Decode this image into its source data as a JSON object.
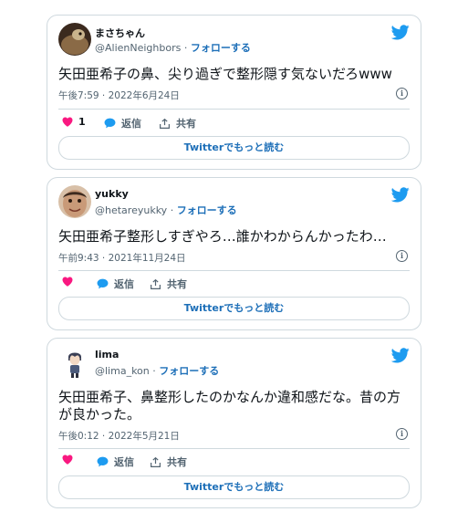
{
  "tweets": [
    {
      "name": "まさちゃん",
      "handle": "@AlienNeighbors",
      "follow_label": "フォローする",
      "text": "矢田亜希子の鼻、尖り過ぎで整形隠す気ないだろwww",
      "timestamp": "午後7:59 · 2022年6月24日",
      "like_count": "1",
      "reply_label": "返信",
      "share_label": "共有",
      "read_more_label": "Twitterでもっと読む"
    },
    {
      "name": "yukky",
      "handle": "@hetareyukky",
      "follow_label": "フォローする",
      "text": "矢田亜希子整形しすぎやろ…誰かわからんかったわ…",
      "timestamp": "午前9:43 · 2021年11月24日",
      "like_count": "",
      "reply_label": "返信",
      "share_label": "共有",
      "read_more_label": "Twitterでもっと読む"
    },
    {
      "name": "lima",
      "handle": "@lima_kon",
      "follow_label": "フォローする",
      "text": "矢田亜希子、鼻整形したのかなんか違和感だな。昔の方が良かった。",
      "timestamp": "午後0:12 · 2022年5月21日",
      "like_count": "",
      "reply_label": "返信",
      "share_label": "共有",
      "read_more_label": "Twitterでもっと読む"
    }
  ],
  "colors": {
    "accent": "#1d9bf0",
    "link": "#1d6fb8",
    "like": "#f91880",
    "muted": "#536471",
    "border": "#cfd9de"
  },
  "icons": {
    "brand": "twitter-bird-icon",
    "like": "heart-icon",
    "reply": "speech-bubble-icon",
    "share": "share-upload-icon",
    "info": "info-icon"
  }
}
